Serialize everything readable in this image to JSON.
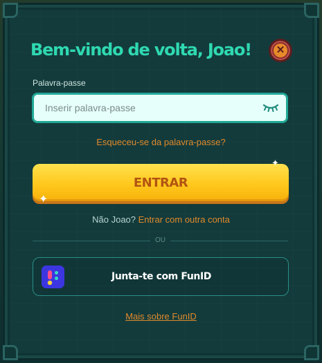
{
  "modal": {
    "title": "Bem-vindo de volta, Joao!",
    "close_icon": "close-icon"
  },
  "password": {
    "label": "Palavra-passe",
    "placeholder": "Inserir palavra-passe",
    "value": "",
    "toggle_icon": "eye-closed-icon"
  },
  "forgot_link": "Esqueceu-se da palavra-passe?",
  "enter_button": "ENTRAR",
  "alt_account": {
    "question": "Não Joao?",
    "link": "Entrar com outra conta"
  },
  "divider_text": "OU",
  "funid": {
    "label": "Junta-te com FunID",
    "logo_icon": "funid-logo-icon"
  },
  "more_link": "Mais sobre FunID",
  "colors": {
    "title": "#2fd9b2",
    "link": "#e08a2b",
    "primary_button": "#ffc81d",
    "primary_button_text": "#b35412",
    "panel": "#133b3c",
    "funid_logo": "#3b36e0"
  }
}
